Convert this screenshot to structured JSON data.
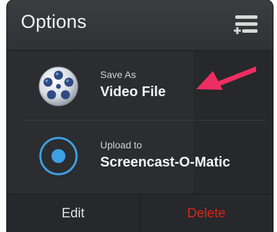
{
  "header": {
    "title": "Options",
    "menu_icon": "menu-add-icon"
  },
  "options": [
    {
      "icon": "film-reel-icon",
      "small_label": "Save As",
      "big_label": "Video File"
    },
    {
      "icon": "record-dot-icon",
      "small_label": "Upload to",
      "big_label": "Screencast-O-Matic"
    }
  ],
  "annotation": {
    "icon": "pointer-arrow-icon",
    "color": "#ee2e63"
  },
  "footer": {
    "edit_label": "Edit",
    "delete_label": "Delete",
    "delete_color": "#e0231b"
  },
  "colors": {
    "panel_bg": "#2a2c2f",
    "accent_blue": "#3da1e6",
    "text_light": "#f4f4f4"
  }
}
